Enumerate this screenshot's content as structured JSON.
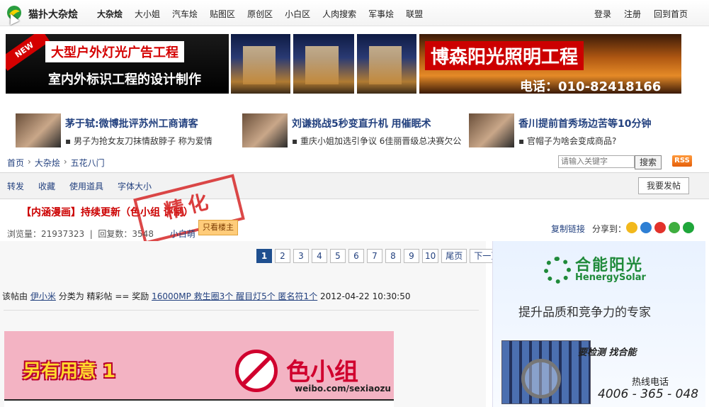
{
  "nav": {
    "brand": "猫扑大杂烩",
    "links": [
      "大杂烩",
      "大小姐",
      "汽车烩",
      "贴图区",
      "原创区",
      "小白区",
      "人肉搜索",
      "军事烩",
      "联盟"
    ],
    "user_links": [
      "登录",
      "注册",
      "回到首页"
    ]
  },
  "banners": {
    "left_new": "NEW",
    "left_line1": "大型户外灯光广告工程",
    "left_line2": "室内外标识工程的设计制作",
    "right_title": "博森阳光照明工程",
    "right_phone": "电话：010-82418166"
  },
  "news": [
    {
      "title": "茅于轼:微博批评苏州工商请客",
      "sub": "▪ 男子为抢女友刀抹情敌脖子 称为爱情"
    },
    {
      "title": "刘谦挑战5秒变直升机 用催眠术",
      "sub": "▪ 重庆小姐加选引争议 6佳丽晋级总决赛欠公"
    },
    {
      "title": "香川提前首秀场边苦等10分钟",
      "sub": "▪ 官帽子为啥会变成商品?"
    }
  ],
  "breadcrumb": [
    "首页",
    "大杂烩",
    "五花八门"
  ],
  "search": {
    "placeholder": "请输入关键字",
    "button": "搜索",
    "rss": "RSS"
  },
  "toolbar": {
    "items": [
      "转发",
      "收藏",
      "使用道具",
      "字体大小"
    ],
    "reply": "我要发帖"
  },
  "post": {
    "title": "【内涵漫画】持续更新（色小组 评制）",
    "stamp": "精化",
    "views_label": "浏览量：",
    "views": "21937323",
    "replies_label": "回复数：",
    "replies": "3548",
    "author": "小白萌",
    "op_only": "只看楼主",
    "copy_link": "复制链接",
    "share_label": "分享到："
  },
  "pager": {
    "pages": [
      "1",
      "2",
      "3",
      "4",
      "5",
      "6",
      "7",
      "8",
      "9",
      "10"
    ],
    "current": "1",
    "last": "尾页",
    "next": "下一页>>"
  },
  "meta": {
    "prefix": "该帖由",
    "author": "伊小米",
    "category_text": "分类为 精彩帖 == 奖励",
    "reward": "16000MP 救生圈3个 醒目灯5个 匿名符1个",
    "date": "2012-04-22 10:30:50"
  },
  "comic": {
    "heading": "另有用意 1",
    "brand": "色小组",
    "weibo": "weibo.com/sexiaozu"
  },
  "ad": {
    "name": "合能阳光",
    "en": "HenergySolar",
    "slogan": "提升品质和竞争力的专家",
    "tagline": "要检测 找合能",
    "hotline": "热线电话",
    "number": "4006 - 365 - 048"
  },
  "colors": {
    "link": "#23417f",
    "title_red": "#c00000",
    "accent_green": "#1f8a3a"
  }
}
